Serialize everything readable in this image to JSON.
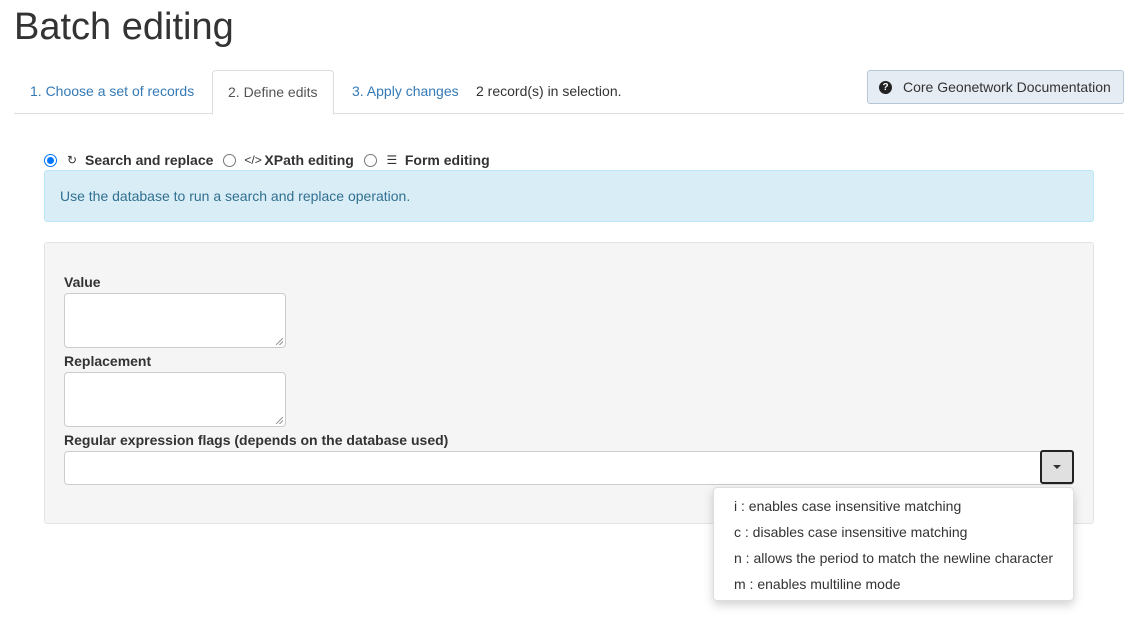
{
  "page": {
    "title": "Batch editing"
  },
  "tabs": [
    {
      "label": "1. Choose a set of records"
    },
    {
      "label": "2. Define edits"
    },
    {
      "label": "3. Apply changes"
    }
  ],
  "selection_info": "2 record(s) in selection.",
  "doc_button": {
    "label": "Core Geonetwork Documentation",
    "icon": "question-circle-icon"
  },
  "modes": [
    {
      "label": "Search and replace",
      "icon": "refresh-icon",
      "checked": true
    },
    {
      "label": "XPath editing",
      "icon": "code-icon",
      "checked": false
    },
    {
      "label": "Form editing",
      "icon": "list-alt-icon",
      "checked": false
    }
  ],
  "alert": {
    "text": "Use the database to run a search and replace operation."
  },
  "form": {
    "value_label": "Value",
    "value": "",
    "replacement_label": "Replacement",
    "replacement": "",
    "flags_label": "Regular expression flags (depends on the database used)",
    "flags_value": ""
  },
  "dropdown": {
    "items": [
      {
        "label": "i : enables case insensitive matching"
      },
      {
        "label": "c : disables case insensitive matching"
      },
      {
        "label": "n : allows the period to match the newline character"
      },
      {
        "label": "m : enables multiline mode"
      }
    ]
  },
  "colors": {
    "link": "#337ab7",
    "alert_bg": "#d9edf7",
    "alert_text": "#31708f",
    "panel_bg": "#f5f5f5",
    "radio_checked": "#0075ff"
  }
}
